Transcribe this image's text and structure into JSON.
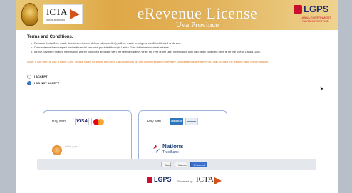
{
  "header": {
    "icta_logo_text": "ICTA",
    "icta_tagline": "ideas actioned",
    "title": "eRevenue License",
    "subtitle": "Uva Province",
    "lgps_logo_text": "LGPS",
    "lgps_tagline": "LANKA GOVERNMENT PAYMENT SERVICE"
  },
  "terms": {
    "heading": "Terms and Conditions.",
    "items": [
      "Refunds that will be made due to service not delivered(cancelled), will be made to original credit/debit card or device.",
      "Convenience fee charged for the financial services provided through Lanka Gate initiative is not refundable.",
      "All the payment related information will be collected and kept with the relevant banks while the rest of the user information that had been collected here is for the use of Lanka Gate."
    ],
    "note": "Note: If you wish to use a Debit Card, please make sure that the Debit Card supports on-line payments and necessary configurations are done.You may contact the issuing bank for verification."
  },
  "agreement": {
    "accept_label": "I ACCEPT",
    "decline_label": "I DO NOT ACCEPT",
    "selected": "decline"
  },
  "payment": {
    "left_panel": {
      "pay_with_label": "Pay with",
      "card1": "VISA",
      "card2": "mastercard",
      "bank_name_line": "සම්පත් බැංකුව"
    },
    "right_panel": {
      "pay_with_label": "Pay with",
      "card1": "AMERICAN EXPRESS",
      "bank_name": "Nations",
      "bank_name_sub": "TrustBank"
    }
  },
  "buttons": {
    "back": "Back",
    "cancel": "Cancel",
    "proceed": "Proceed"
  },
  "footer": {
    "lgps": "LGPS",
    "powered_by": "Powered by",
    "icta": "ICTA"
  },
  "colors": {
    "header_gold": "#dfa847",
    "note_orange": "#e07b1f",
    "primary_button": "#3a6fd0",
    "panel_border": "#9fb4d8"
  }
}
